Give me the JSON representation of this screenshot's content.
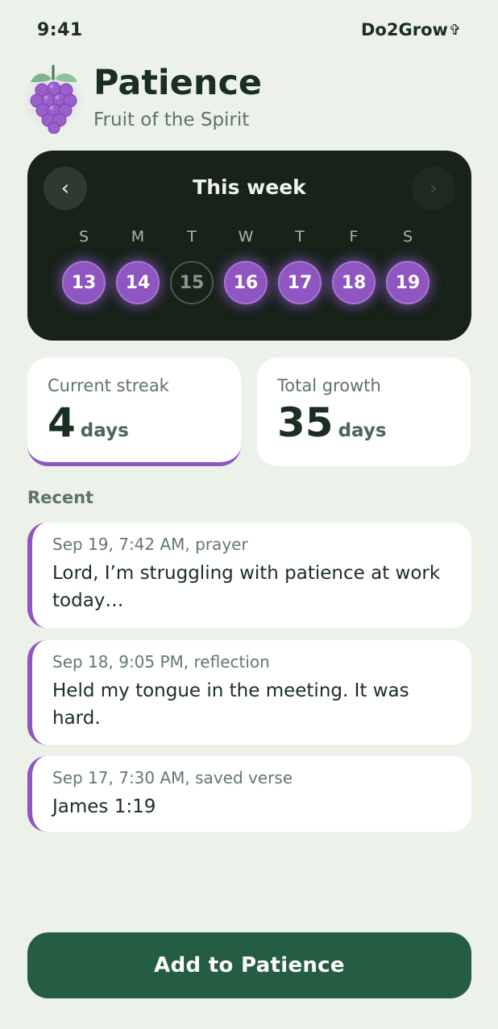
{
  "status_bar": {
    "time": "9:41",
    "brand": "Do2Grow",
    "brand_icon": "cross-icon"
  },
  "header": {
    "title": "Patience",
    "subtitle": "Fruit of the Spirit",
    "icon": "grapes-icon"
  },
  "week": {
    "title": "This week",
    "prev_icon": "chevron-left-icon",
    "next_icon": "chevron-right-icon",
    "days": [
      {
        "letter": "S",
        "date": "13",
        "done": true
      },
      {
        "letter": "M",
        "date": "14",
        "done": true
      },
      {
        "letter": "T",
        "date": "15",
        "done": false
      },
      {
        "letter": "W",
        "date": "16",
        "done": true
      },
      {
        "letter": "T",
        "date": "17",
        "done": true
      },
      {
        "letter": "F",
        "date": "18",
        "done": true
      },
      {
        "letter": "S",
        "date": "19",
        "done": true
      }
    ]
  },
  "stats": {
    "streak": {
      "label": "Current streak",
      "value": "4",
      "unit": "days"
    },
    "growth": {
      "label": "Total growth",
      "value": "35",
      "unit": "days"
    }
  },
  "recent": {
    "label": "Recent",
    "entries": [
      {
        "meta": "Sep 19, 7:42 AM, prayer",
        "text": "Lord, I’m struggling with patience at work today…"
      },
      {
        "meta": "Sep 18, 9:05 PM, reflection",
        "text": "Held my tongue in the meeting. It was hard."
      },
      {
        "meta": "Sep 17, 7:30 AM, saved verse",
        "text": "James 1:19"
      }
    ]
  },
  "action": {
    "label": "Add to Patience"
  },
  "colors": {
    "background": "#ecf1ea",
    "accent_purple": "#8f55c0",
    "dark_card": "#172219",
    "primary_green": "#245d42"
  }
}
